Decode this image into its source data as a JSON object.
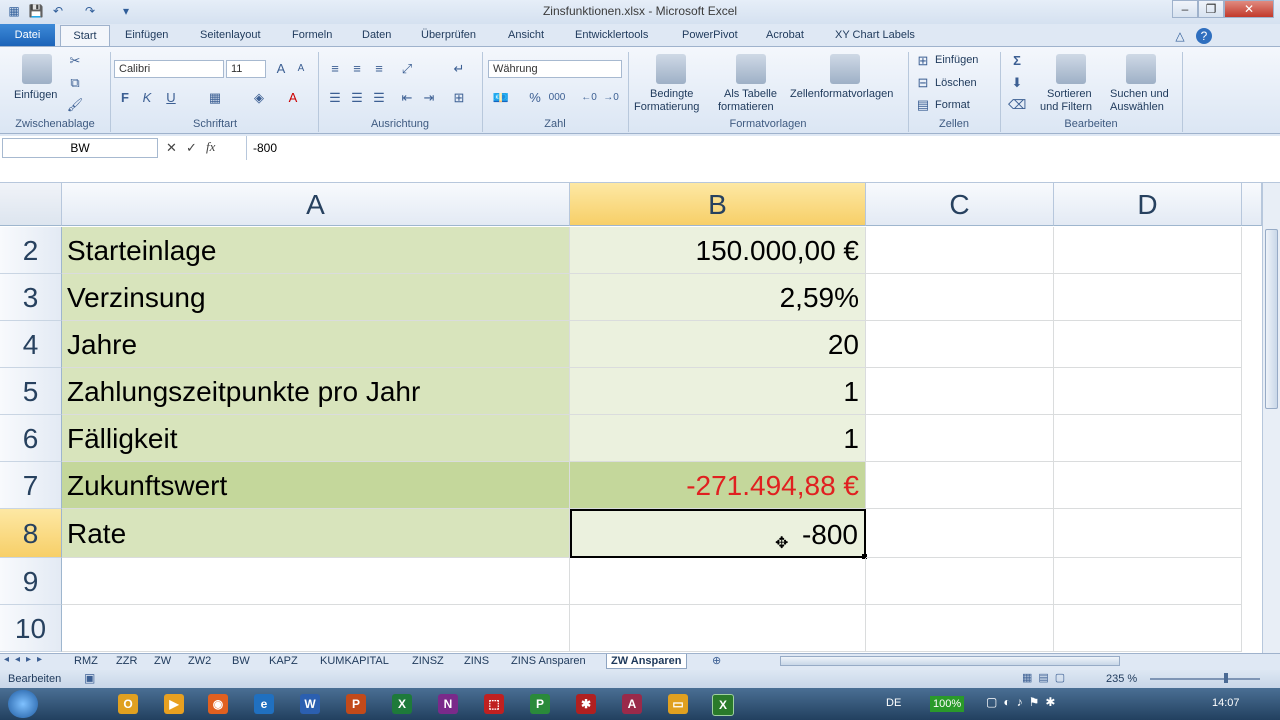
{
  "window": {
    "title": "Zinsfunktionen.xlsx - Microsoft Excel"
  },
  "ribbon_tabs": [
    "Datei",
    "Start",
    "Einfügen",
    "Seitenlayout",
    "Formeln",
    "Daten",
    "Überprüfen",
    "Ansicht",
    "Entwicklertools",
    "PowerPivot",
    "Acrobat",
    "XY Chart Labels"
  ],
  "clipboard": {
    "paste": "Einfügen",
    "group": "Zwischenablage"
  },
  "font": {
    "name": "Calibri",
    "size": "11",
    "bold": "F",
    "italic": "K",
    "underline": "U",
    "group": "Schriftart"
  },
  "alignment": {
    "group": "Ausrichtung"
  },
  "number": {
    "format": "Währung",
    "percent": "%",
    "thousands": "000",
    "group": "Zahl"
  },
  "styles": {
    "conditional": "Bedingte",
    "conditional2": "Formatierung",
    "astable": "Als Tabelle",
    "astable2": "formatieren",
    "cellstyles": "Zellenformatvorlagen",
    "group": "Formatvorlagen"
  },
  "cells_group": {
    "insert": "Einfügen",
    "delete": "Löschen",
    "format": "Format",
    "group": "Zellen"
  },
  "editing": {
    "sort": "Sortieren",
    "sort2": "und Filtern",
    "find": "Suchen und",
    "find2": "Auswählen",
    "group": "Bearbeiten"
  },
  "formula_bar": {
    "name_box": "BW",
    "fx": "fx",
    "formula": "-800"
  },
  "columns": [
    "A",
    "B",
    "C",
    "D"
  ],
  "rows": [
    {
      "num": "2",
      "label": "Starteinlage",
      "value": "150.000,00 €"
    },
    {
      "num": "3",
      "label": "Verzinsung",
      "value": "2,59%"
    },
    {
      "num": "4",
      "label": "Jahre",
      "value": "20"
    },
    {
      "num": "5",
      "label": "Zahlungszeitpunkte pro Jahr",
      "value": "1"
    },
    {
      "num": "6",
      "label": "Fälligkeit",
      "value": "1"
    },
    {
      "num": "7",
      "label": "Zukunftswert",
      "value": "-271.494,88 €"
    },
    {
      "num": "8",
      "label": "Rate",
      "value": "-800"
    },
    {
      "num": "9",
      "label": "",
      "value": ""
    },
    {
      "num": "10",
      "label": "",
      "value": ""
    }
  ],
  "sheets": [
    "RMZ",
    "ZZR",
    "ZW",
    "ZW2",
    "BW",
    "KAPZ",
    "KUMKAPITAL",
    "ZINSZ",
    "ZINS",
    "ZINS Ansparen",
    "ZW Ansparen"
  ],
  "status": {
    "mode": "Bearbeiten",
    "zoom": "235 %"
  },
  "taskbar": {
    "lang": "DE",
    "battery": "100%",
    "time": "14:07"
  },
  "colors": {
    "label_fill": "#d8e4bc",
    "value_fill": "#ebf1de",
    "highlight_fill": "#c4d79b",
    "negative": "#e02020",
    "selection": "#f7cf68"
  }
}
